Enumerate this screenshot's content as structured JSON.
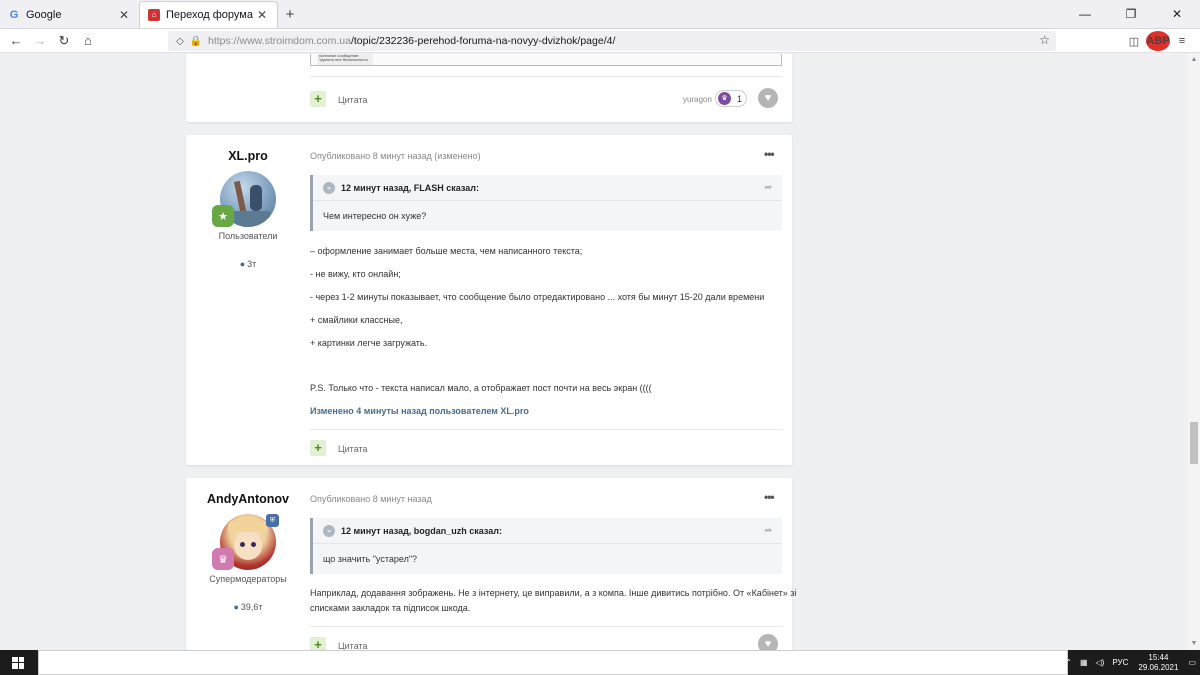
{
  "browser": {
    "tabs": [
      {
        "title": "Google",
        "favicon": "google-icon",
        "active": false
      },
      {
        "title": "Переход форума на новый д",
        "favicon": "site-home-icon",
        "active": true
      }
    ],
    "url_host": "https://www.stroimdom.com.ua",
    "url_path": "/topic/232236-perehod-foruma-na-novyy-dvizhok/page/4/"
  },
  "prev_post": {
    "quote_label": "Цитата",
    "liker": "yuragon",
    "like_count": "1",
    "screenshot_text": "сообщ. нового пост. за это полезное сообщение. Удалить все безопасность"
  },
  "posts": [
    {
      "author": "XL.pro",
      "role": "Пользователи",
      "post_count": "3т",
      "meta": "Опубликовано 8 минут назад (изменено)",
      "quote_header": "12 минут назад, FLASH сказал:",
      "quote_text": "Чем интересно он хуже?",
      "lines": [
        "– оформление занимает больше места, чем написанного текста;",
        "- не вижу, кто онлайн;",
        "- через 1-2 минуты показывает, что сообщение было отредактировано ... хотя бы минут 15-20 дали времени",
        "+ смайлики классные,",
        "+ картинки легче загружать.",
        "P.S. Только что - текста написал мало, а отображает пост почти на весь экран ((((",
        "Изменено 4 минуты назад пользователем XL.pro"
      ],
      "quote_label": "Цитата"
    },
    {
      "author": "AndyAntonov",
      "role": "Супермодераторы",
      "post_count": "39,6т",
      "meta": "Опубликовано 8 минут назад",
      "quote_header": "12 минут назад, bogdan_uzh сказал:",
      "quote_text": "що значить \"устарел\"?",
      "lines": [
        "Наприклад, додавання зображень. Не з інтернету, це виправили, а з компа. Інше дивитись потрібно. От «Кабінет» зі",
        "списками закладок та підписок шкода."
      ],
      "quote_label": "Цитата"
    }
  ],
  "taskbar": {
    "lang": "РУС",
    "time": "15:44",
    "date": "29.06.2021"
  },
  "colors": {
    "accent": "#4a6b8a",
    "plus_bg": "#e2f0d4",
    "plus_fg": "#4f8a1f"
  }
}
